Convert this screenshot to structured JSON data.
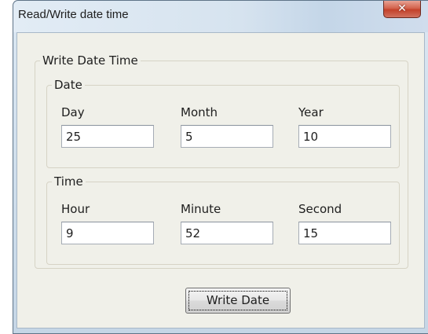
{
  "window": {
    "title": "Read/Write date time",
    "close_glyph": "✕"
  },
  "write_group": {
    "legend": "Write Date Time",
    "date_group": {
      "legend": "Date",
      "day_label": "Day",
      "day_value": "25",
      "month_label": "Month",
      "month_value": "5",
      "year_label": "Year",
      "year_value": "10"
    },
    "time_group": {
      "legend": "Time",
      "hour_label": "Hour",
      "hour_value": "9",
      "minute_label": "Minute",
      "minute_value": "52",
      "second_label": "Second",
      "second_value": "15"
    }
  },
  "write_button_label": "Write Date",
  "colors": {
    "dialog_face": "#f0f0e9",
    "close_button": "#c3412a",
    "groupbox_border": "#d6d3c5"
  },
  "icons": {
    "close": "close-icon"
  }
}
